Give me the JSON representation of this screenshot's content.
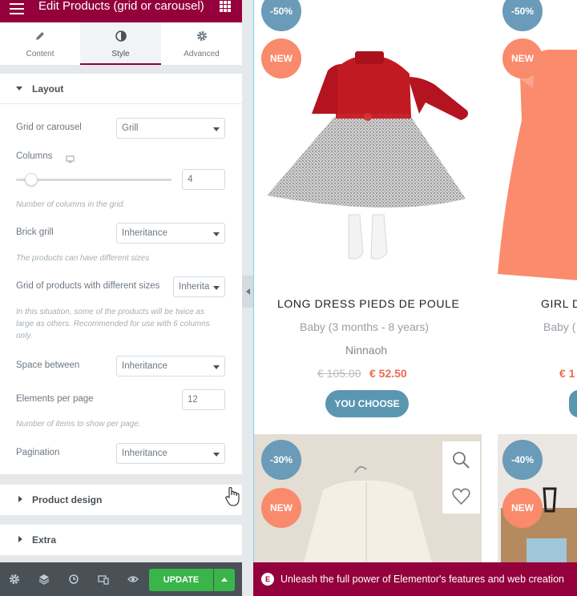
{
  "topbar": {
    "title": "Edit Products (grid or carousel)"
  },
  "tabs": [
    {
      "label": "Content",
      "icon": "pencil-icon"
    },
    {
      "label": "Style",
      "icon": "half-circle-icon"
    },
    {
      "label": "Advanced",
      "icon": "gear-icon"
    }
  ],
  "layout": {
    "title": "Layout",
    "grid_or_carousel": {
      "label": "Grid or carousel",
      "value": "Grill"
    },
    "columns": {
      "label": "Columns",
      "value": "4",
      "slider_fraction": 0.1,
      "note": "Number of columns in the grid."
    },
    "brick_grill": {
      "label": "Brick grill",
      "value": "Inheritance",
      "note": "The products can have different sizes"
    },
    "diff_sizes": {
      "label": "Grid of products with different sizes",
      "value": "Inherita",
      "note": "In this situation, some of the products will be twice as large as others. Recommended for use with 6 columns only."
    },
    "space_between": {
      "label": "Space between",
      "value": "Inheritance"
    },
    "elements_per_page": {
      "label": "Elements per page",
      "value": "12",
      "note": "Number of items to show per page."
    },
    "pagination": {
      "label": "Pagination",
      "value": "Inheritance"
    }
  },
  "sections": {
    "product_design": "Product design",
    "extra": "Extra"
  },
  "bottombar": {
    "update_label": "UPDATE"
  },
  "products": [
    {
      "discount": "-50%",
      "new": "NEW",
      "name": "LONG DRESS PIEDS DE POULE",
      "category": "Baby (3 months - 8 years)",
      "brand": "Ninnaoh",
      "old_price": "€ 105.00",
      "price": "€ 52.50",
      "button": "YOU CHOOSE"
    },
    {
      "discount": "-50%",
      "new": "NEW",
      "name": "GIRL D",
      "category": "Baby (",
      "price": "€ 1"
    },
    {
      "discount": "-30%",
      "new": "NEW"
    },
    {
      "discount": "-40%",
      "new": "NEW"
    }
  ],
  "promo": {
    "text": "Unleash the full power of Elementor's features and web creation"
  },
  "colors": {
    "brand": "#93003c",
    "update_green": "#39b54a",
    "badge_discount": "#6a9bb8",
    "badge_new": "#f98a6b",
    "sale_price": "#ef6b4f"
  }
}
